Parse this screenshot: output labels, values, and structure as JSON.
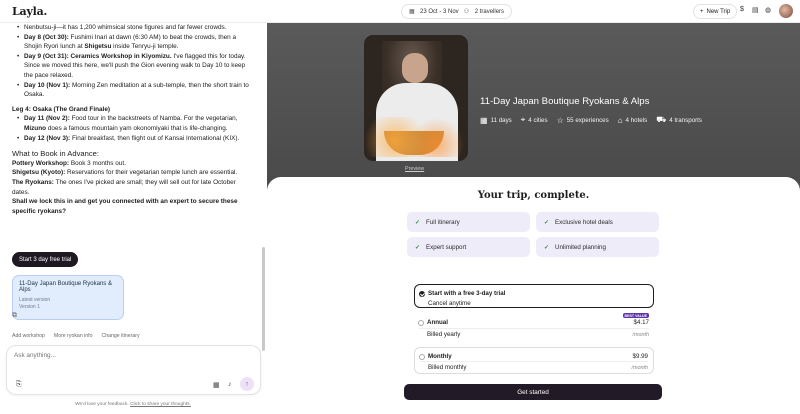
{
  "topbar": {
    "logo": "Layla.",
    "dates": "23 Oct - 3 Nov",
    "travellers": "2 travellers",
    "new_trip": "New Trip",
    "currency": "$"
  },
  "chat": {
    "intro": "Nenbutsu-ji—it has 1,200 whimsical stone figures and far fewer crowds.",
    "leg3_items": [
      {
        "label": "Day 8 (Oct 30):",
        "pre": " Fushimi Inari at dawn (6:30 AM) to beat the crowds, then a Shojin Ryori lunch at ",
        "bold2": "Shigetsu",
        "post": " inside Tenryu-ji temple."
      },
      {
        "label": "Day 9 (Oct 31): Ceramics Workshop in Kiyomizu.",
        "pre": " I've flagged this for today. Since we moved this here, we'll push the Gion evening walk to Day 10 to keep the pace relaxed."
      },
      {
        "label": "Day 10 (Nov 1):",
        "pre": " Morning Zen meditation at a sub-temple, then the short train to Osaka."
      }
    ],
    "leg4_title": "Leg 4: Osaka (The Grand Finale)",
    "leg4_items": [
      {
        "label": "Day 11 (Nov 2):",
        "pre": " Food tour in the backstreets of Namba. For the vegetarian, ",
        "bold2": "Mizuno",
        "post": " does a famous mountain yam okonomiyaki that is life-changing."
      },
      {
        "label": "Day 12 (Nov 3):",
        "pre": " Final breakfast, then flight out of Kansai International (KIX)."
      }
    ],
    "advance_title": "What to Book in Advance:",
    "advance_items": [
      {
        "label": "Pottery Workshop:",
        "text": " Book 3 months out."
      },
      {
        "label": "Shigetsu (Kyoto):",
        "text": " Reservations for their vegetarian temple lunch are essential."
      },
      {
        "label": "The Ryokans:",
        "text": " The ones I've picked are small; they will sell out for late October dates."
      }
    ],
    "closing": "Shall we lock this in and get you connected with an expert to secure these specific ryokans?"
  },
  "trial_button": "Start 3 day free trial",
  "version_card": {
    "title": "11-Day Japan Boutique Ryokans & Alps",
    "status": "Latest version",
    "version": "Version 1"
  },
  "suggestions": [
    "Add workshop",
    "More ryokan info",
    "Change itinerary"
  ],
  "input": {
    "placeholder": "Ask anything..."
  },
  "feedback": {
    "text": "We'd love your feedback.",
    "link": "Click to share your thoughts."
  },
  "trip": {
    "preview_label": "Preview",
    "title": "11-Day Japan Boutique Ryokans & Alps",
    "stats": [
      "11 days",
      "4 cities",
      "55 experiences",
      "4 hotels",
      "4 transports"
    ]
  },
  "paywall": {
    "title": "Your trip, complete.",
    "features": [
      "Full itinerary",
      "Exclusive hotel deals",
      "Expert support",
      "Unlimited planning"
    ],
    "plans": {
      "trial": {
        "name": "Start with a free 3-day trial",
        "sub": "Cancel anytime"
      },
      "annual": {
        "name": "Annual",
        "badge": "BEST VALUE",
        "price": "$4.17",
        "sub": "Billed yearly",
        "per": "/month"
      },
      "monthly": {
        "name": "Monthly",
        "price": "$9.99",
        "sub": "Billed monthly",
        "per": "/month"
      }
    },
    "cta": "Get started"
  }
}
